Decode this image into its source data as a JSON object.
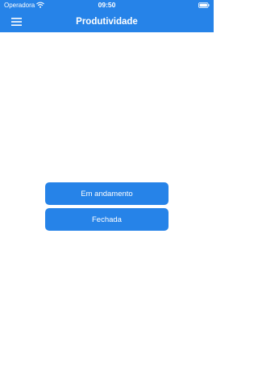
{
  "status_bar": {
    "carrier": "Operadora",
    "time": "09:50",
    "wifi_icon": "wifi-icon",
    "battery_icon": "battery-icon"
  },
  "header": {
    "title": "Produtividade",
    "menu_icon": "hamburger-menu-icon",
    "background_color": "#2683e8"
  },
  "actions": {
    "in_progress_label": "Em andamento",
    "closed_label": "Fechada",
    "button_color": "#2683e8"
  }
}
